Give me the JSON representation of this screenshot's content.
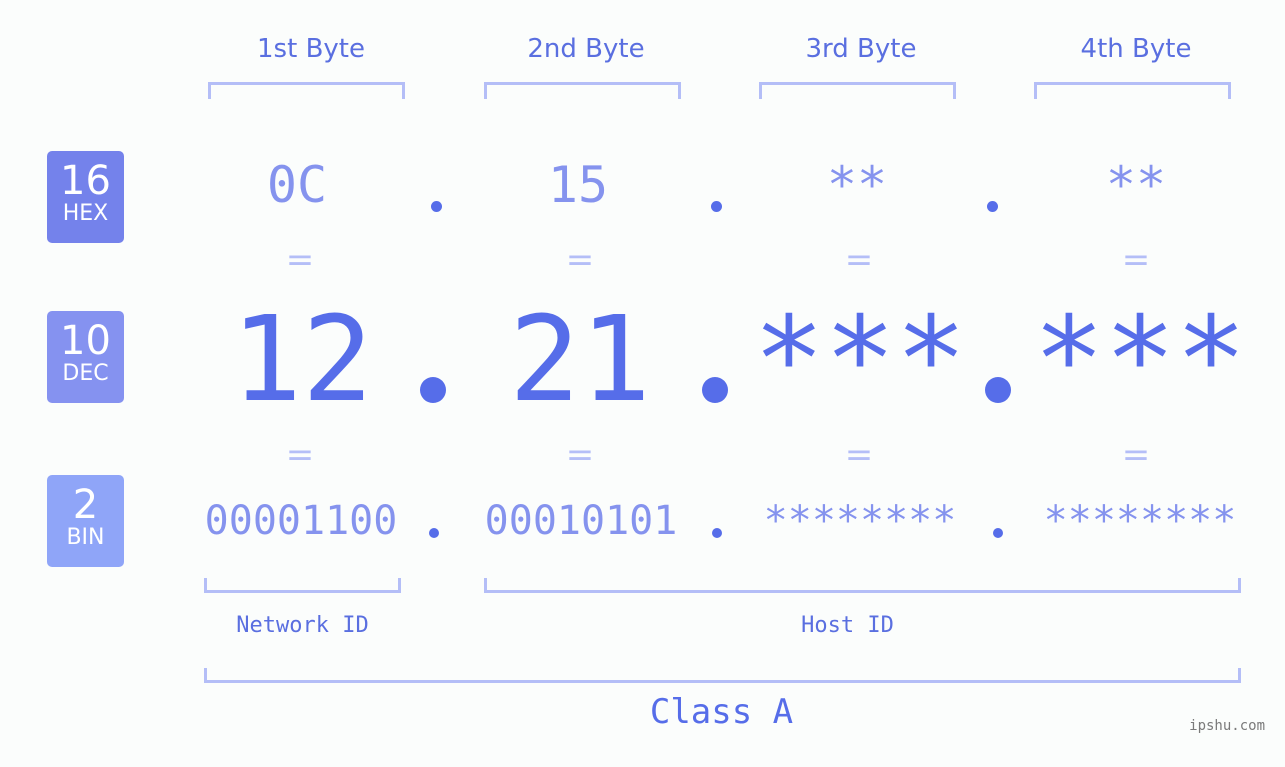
{
  "byte_headers": [
    "1st Byte",
    "2nd Byte",
    "3rd Byte",
    "4th Byte"
  ],
  "rows": {
    "hex": {
      "base": "16",
      "label": "HEX",
      "values": [
        "0C",
        "15",
        "**",
        "**"
      ],
      "color": "#7482eb"
    },
    "dec": {
      "base": "10",
      "label": "DEC",
      "values": [
        "12",
        "21",
        "***",
        "***"
      ],
      "color": "#8592f0"
    },
    "bin": {
      "base": "2",
      "label": "BIN",
      "values": [
        "00001100",
        "00010101",
        "********",
        "********"
      ],
      "color": "#8fa5f8"
    }
  },
  "equals_sign": "=",
  "network_id_label": "Network ID",
  "host_id_label": "Host ID",
  "class_label": "Class A",
  "watermark": "ipshu.com"
}
